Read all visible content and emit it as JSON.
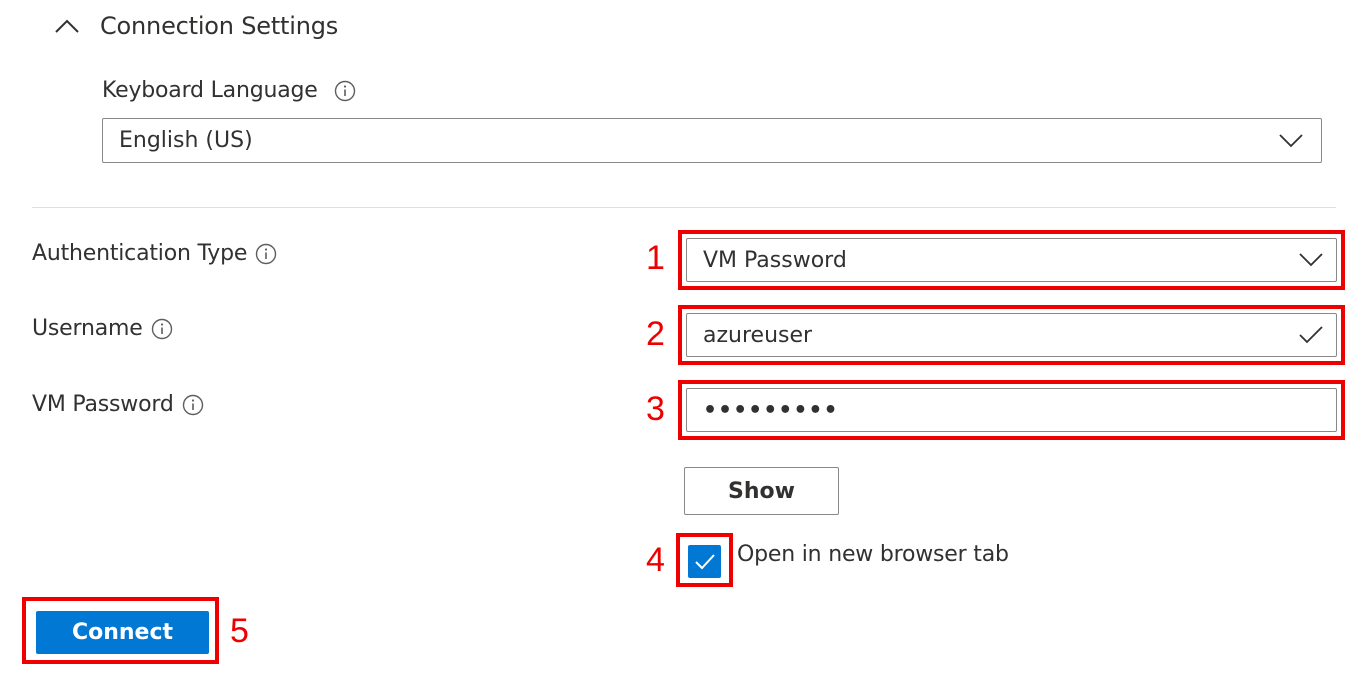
{
  "section": {
    "title": "Connection Settings"
  },
  "keyboard_language": {
    "label": "Keyboard Language",
    "value": "English (US)"
  },
  "auth_type": {
    "label": "Authentication Type",
    "value": "VM Password",
    "marker": "1"
  },
  "username": {
    "label": "Username",
    "value": "azureuser",
    "marker": "2"
  },
  "vm_password": {
    "label": "VM Password",
    "value": "•••••••••",
    "marker": "3"
  },
  "show_button": {
    "label": "Show"
  },
  "new_tab": {
    "label": "Open in new browser tab",
    "checked": true,
    "marker": "4"
  },
  "connect": {
    "label": "Connect",
    "marker": "5"
  },
  "colors": {
    "accent": "#0078d4",
    "highlight": "#ee0000",
    "border": "#8a8886",
    "text": "#323130"
  },
  "icons": {
    "section_toggle": "chevron-up-icon",
    "info": "info-icon",
    "dropdown": "chevron-down-icon",
    "valid": "checkmark-icon",
    "checkbox": "checkmark-icon"
  }
}
